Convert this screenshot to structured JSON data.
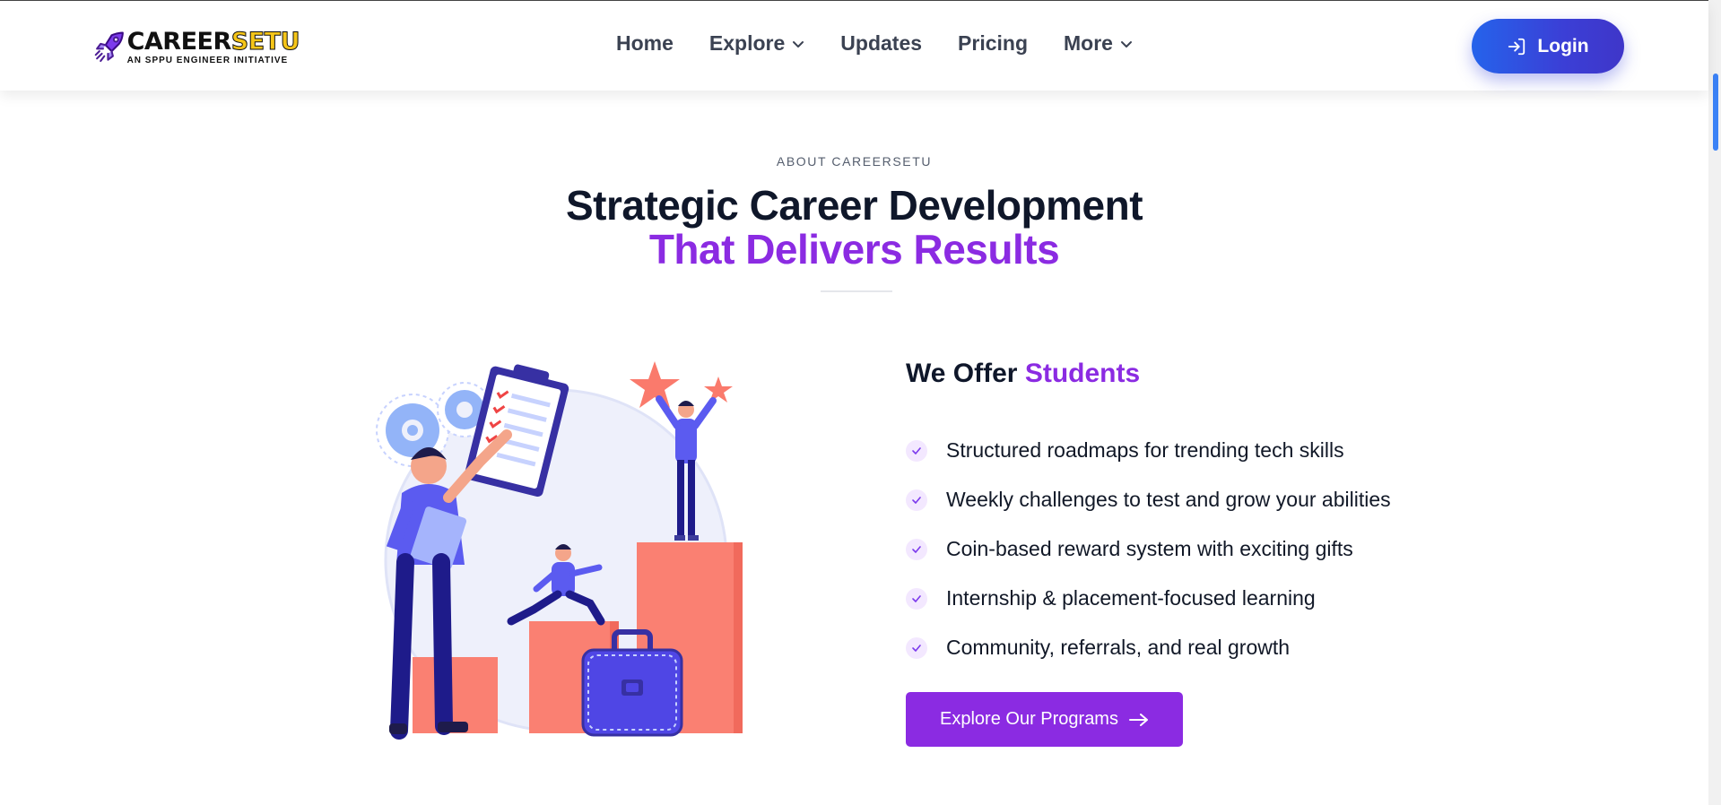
{
  "header": {
    "logo": {
      "main_a": "CAREER",
      "main_b": "SETU",
      "sub": "AN SPPU ENGINEER INITIATIVE"
    },
    "nav": [
      {
        "label": "Home",
        "dropdown": false
      },
      {
        "label": "Explore",
        "dropdown": true
      },
      {
        "label": "Updates",
        "dropdown": false
      },
      {
        "label": "Pricing",
        "dropdown": false
      },
      {
        "label": "More",
        "dropdown": true
      }
    ],
    "login_label": "Login"
  },
  "about": {
    "eyebrow": "ABOUT CAREERSETU",
    "title_line1": "Strategic Career Development",
    "title_line2": "That Delivers Results"
  },
  "offer": {
    "title_prefix": "We Offer",
    "title_highlight": "Students",
    "items": [
      "Structured roadmaps for trending tech skills",
      "Weekly challenges to test and grow your abilities",
      "Coin-based reward system with exciting gifts",
      "Internship & placement-focused learning",
      "Community, referrals, and real growth"
    ],
    "cta_label": "Explore Our Programs"
  },
  "colors": {
    "brand_purple": "#8b2be2",
    "login_blue": "#2563eb",
    "bar_coral": "#fa8072",
    "figure_blue": "#5b5bf0"
  }
}
